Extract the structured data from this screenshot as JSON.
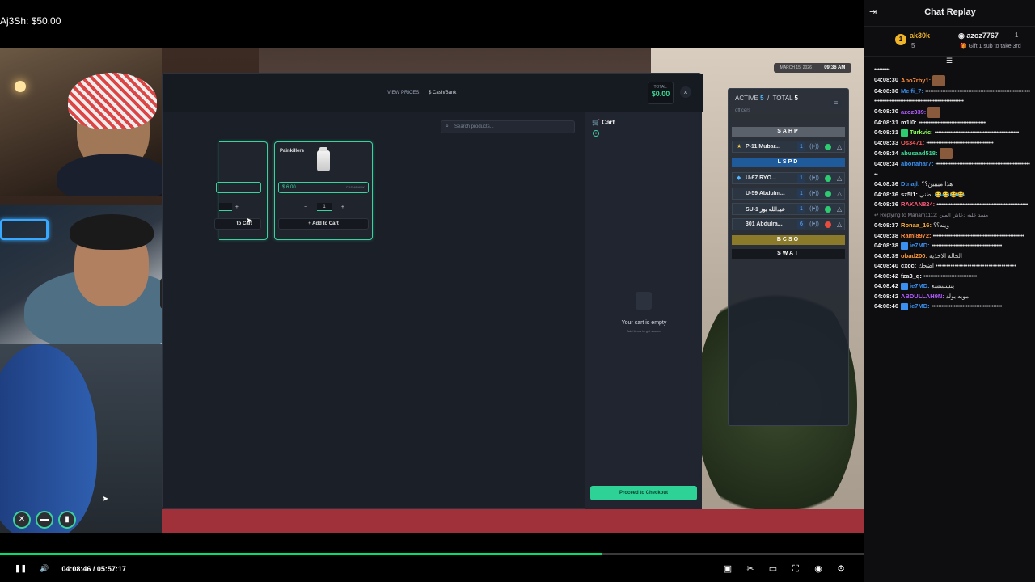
{
  "overlay": {
    "donation": "Aj3Sh: $50.00"
  },
  "shop": {
    "view_prices_label": "VIEW PRICES:",
    "view_prices_value": "$ Cash/Bank",
    "total_label": "TOTAL:",
    "total_value": "$0.00",
    "close": "×",
    "search_placeholder": "Search products...",
    "products": [
      {
        "name": "",
        "add_label": "to Cart"
      },
      {
        "name": "Painkillers",
        "price": "$ 6.00",
        "price_method": "CASH/BANK",
        "qty": "1",
        "add_label": "+ Add to Cart"
      }
    ],
    "cart": {
      "title": "Cart",
      "count": "0",
      "empty_title": "Your cart is empty",
      "empty_sub": "Add items to get started",
      "checkout_label": "Proceed to Checkout"
    }
  },
  "clock": {
    "date": "MARCH 15, 2026",
    "time": "09:36 AM"
  },
  "dispatch": {
    "active_label": "ACTIVE",
    "active": "5",
    "total_label": "TOTAL",
    "total": "5",
    "officers_label": "officers",
    "departments": [
      "SAHP",
      "LSPD",
      "BCSO",
      "SWAT"
    ],
    "units": [
      {
        "name": "P-11 Mubar...",
        "num": "1",
        "status_color": "#2ecc71"
      },
      {
        "name": "U-67 RYO...",
        "num": "1",
        "status_color": "#2ecc71"
      },
      {
        "name": "U-59 Abdulm...",
        "num": "1",
        "status_color": "#2ecc71"
      },
      {
        "name": "SU-1 عبدالله بوز",
        "num": "1",
        "status_color": "#2ecc71"
      },
      {
        "name": "301 Abdulra...",
        "num": "6",
        "status_color": "#e74c3c"
      }
    ]
  },
  "player": {
    "time_current": "04:08:46",
    "time_sep": "/",
    "time_total": "05:57:17",
    "progress_fraction": 0.697
  },
  "chat": {
    "title": "Chat Replay",
    "leader": {
      "rank": "1",
      "user1": "ak30k",
      "count1": "5",
      "user2": "azoz7767",
      "count2": "1",
      "gift_text": "Gift 1 sub to take 3rd"
    },
    "messages": [
      {
        "time": "",
        "user": "",
        "color": "#efeff1",
        "text": "•••••••••"
      },
      {
        "time": "04:08:30",
        "user": "Abo7rby1:",
        "color": "#ff8c3a",
        "text": ""
      },
      {
        "time": "04:08:30",
        "user": "Melfi_7:",
        "color": "#3a8ff0",
        "text": "•••••••••••••••••••••••••••••••••••••••••••••••••••••••••••••••••••••••••••••••••••••••••••••••••••••••••••••••••"
      },
      {
        "time": "04:08:30",
        "user": "azoz339:",
        "color": "#b05cff",
        "text": ""
      },
      {
        "time": "04:08:31",
        "user": "m1l0:",
        "color": "#efeff1",
        "text": "•••••••••••••••••••••••••••••••••••••••"
      },
      {
        "time": "04:08:31",
        "user": "Turkvic:",
        "color": "#8cff5a",
        "text": "•••••••••••••••••••••••••••••••••••••••••••••••••"
      },
      {
        "time": "04:08:33",
        "user": "Os3471:",
        "color": "#ff5a5a",
        "text": "•••••••••••••••••••••••••••••••••••••••"
      },
      {
        "time": "04:08:34",
        "user": "abusaad518:",
        "color": "#3ddc97",
        "text": ""
      },
      {
        "time": "04:08:34",
        "user": "abonahar7:",
        "color": "#3a8ff0",
        "text": "•••••••••••••••••••••••••••••••••••••••••••••••••••••••••"
      },
      {
        "time": "04:08:36",
        "user": "Dtnajl:",
        "color": "#3a8ff0",
        "text": "هذا ميييين؟؟"
      },
      {
        "time": "04:08:36",
        "user": "sz5l1:",
        "color": "#efeff1",
        "text": "بطني 😂😂😂😂"
      },
      {
        "time": "04:08:36",
        "user": "RAKAN824:",
        "color": "#ff5a7a",
        "text": "•••••••••••••••••••••••••••••••••••••••••••••••••••••"
      },
      {
        "reply": "Replying to Mariam1112: مسد عليه دعاش المين"
      },
      {
        "time": "04:08:37",
        "user": "Ronaa_16:",
        "color": "#ffb03a",
        "text": "وينه؟؟"
      },
      {
        "time": "04:08:38",
        "user": "Rami8972:",
        "color": "#ff8c3a",
        "text": "•••••••••••••••••••••••••••••••••••••••••••••••••••••"
      },
      {
        "time": "04:08:38",
        "user": "ie7MD:",
        "color": "#3a8ff0",
        "text": "•••••••••••••••••••••••••••••••••••••••••"
      },
      {
        "time": "04:08:39",
        "user": "obad200:",
        "color": "#ff9c3a",
        "text": "الحاله الاحذيه"
      },
      {
        "time": "04:08:40",
        "user": "cxcc:",
        "color": "#efeff1",
        "text": "اضحك ••••••••••••••••••••••••••••••••••••••"
      },
      {
        "time": "04:08:42",
        "user": "fza3_q:",
        "color": "#efeff1",
        "text": "•••••••••••••••••••••••••••••••"
      },
      {
        "time": "04:08:42",
        "user": "ie7MD:",
        "color": "#3a8ff0",
        "text": "يتشسسع"
      },
      {
        "time": "04:08:42",
        "user": "ABDULLAH9N:",
        "color": "#b05cff",
        "text": "مويه بولد"
      },
      {
        "time": "04:08:46",
        "user": "ie7MD:",
        "color": "#3a8ff0",
        "text": "•••••••••••••••••••••••••••••••••••••••••"
      }
    ]
  }
}
